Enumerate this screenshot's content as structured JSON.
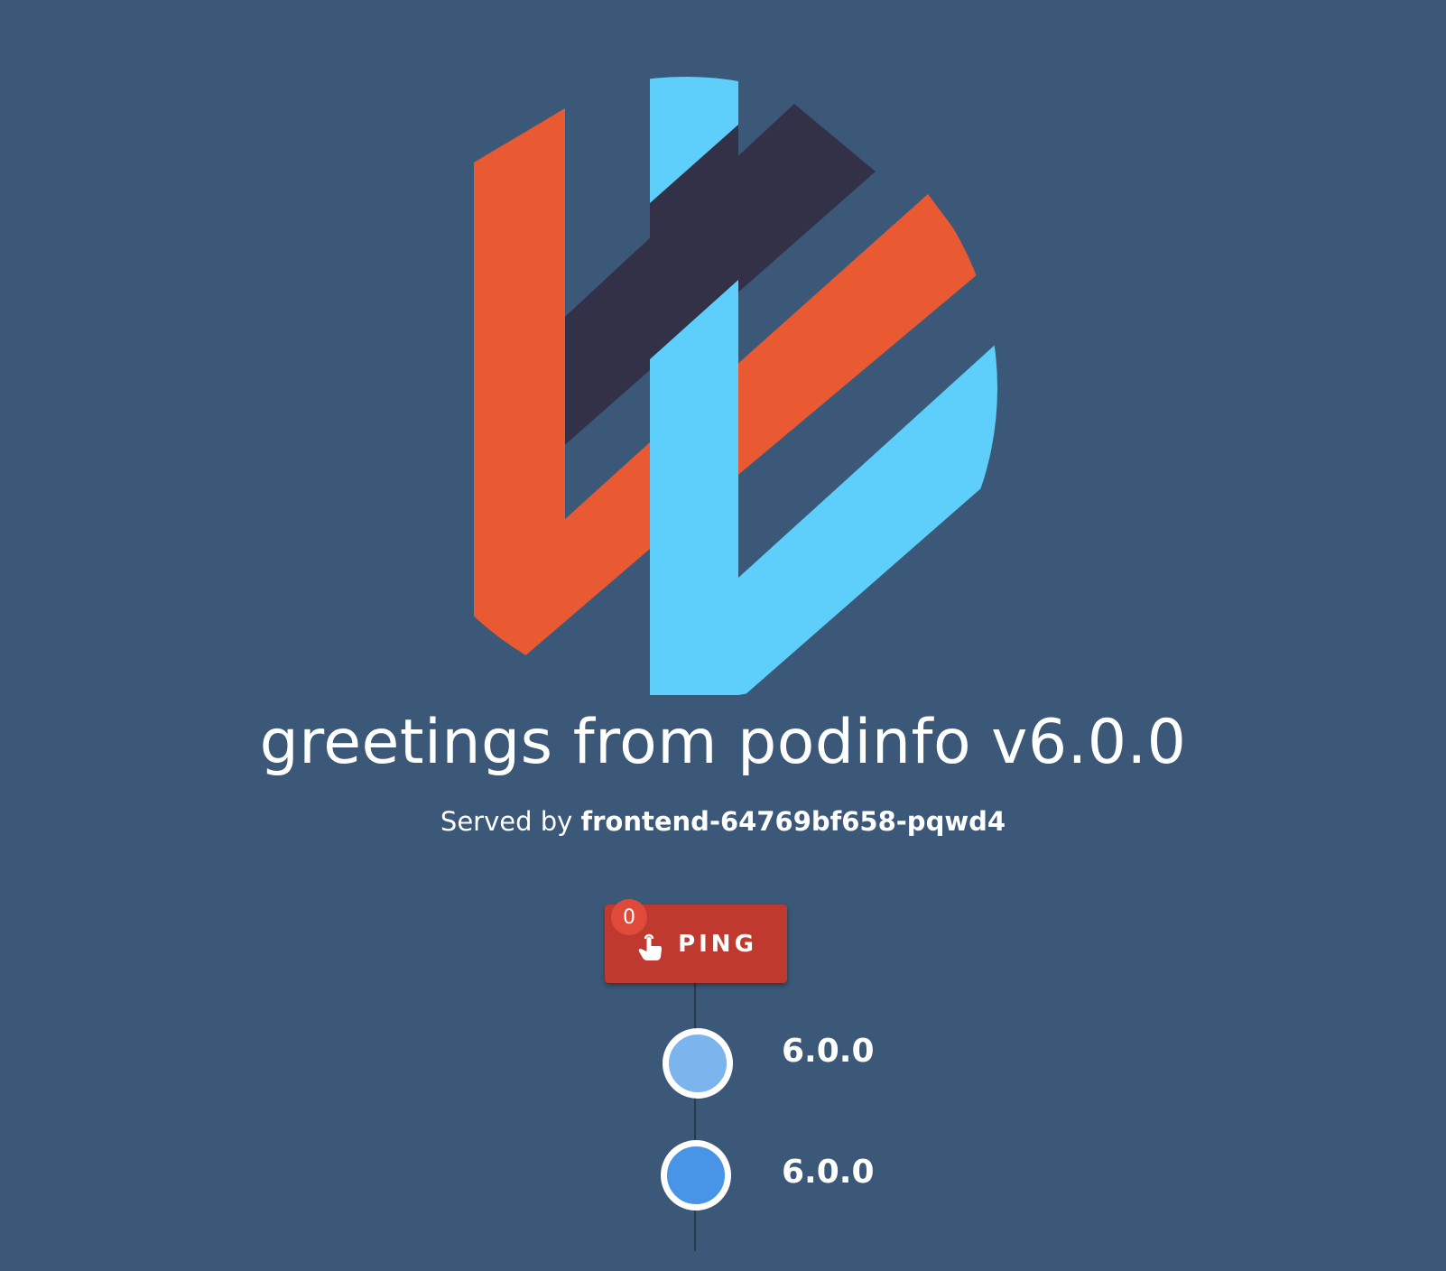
{
  "logo": {
    "icon": "podinfo-logo",
    "colors": [
      "#e95a32",
      "#5dcffa",
      "#323147"
    ]
  },
  "header": {
    "title": "greetings from podinfo v6.0.0",
    "served_prefix": "Served by ",
    "served_host": "frontend-64769bf658-pqwd4"
  },
  "ping": {
    "label": "PING",
    "badge": "0",
    "icon": "touch-hand-icon",
    "color": "#c0392f"
  },
  "timeline": {
    "items": [
      {
        "version": "6.0.0",
        "color": "#7cb4ee"
      },
      {
        "version": "6.0.0",
        "color": "#4894e6"
      }
    ]
  }
}
